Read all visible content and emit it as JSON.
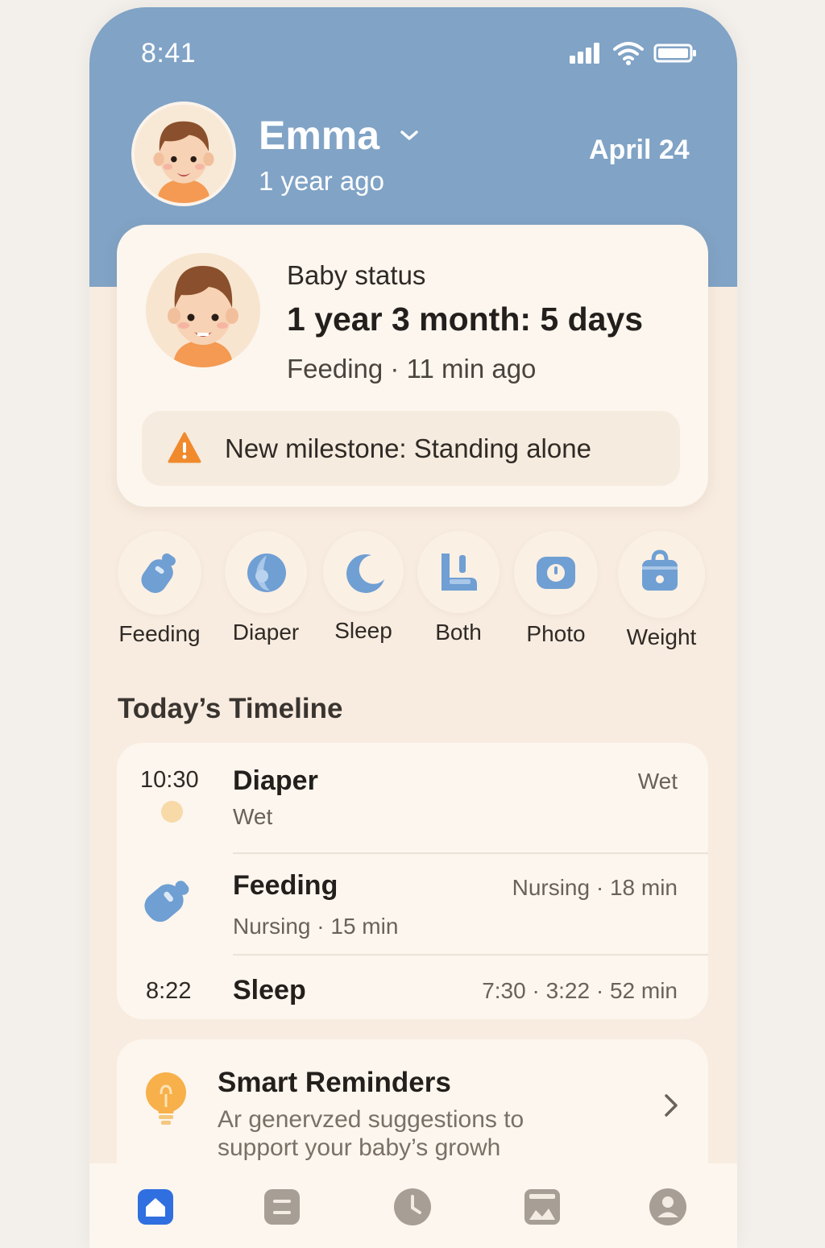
{
  "status_bar": {
    "time": "8:41"
  },
  "profile": {
    "name": "Emma",
    "age_text": "1 year ago",
    "date": "April 24"
  },
  "baby_status": {
    "label": "Baby status",
    "age": "1 year 3 month: 5 days",
    "last_activity": "Feeding · 11 min ago",
    "milestone": "New milestone: Standing alone"
  },
  "quick_actions": [
    {
      "label": "Feeding",
      "icon": "bottle-icon"
    },
    {
      "label": "Diaper",
      "icon": "diaper-icon"
    },
    {
      "label": "Sleep",
      "icon": "moon-icon"
    },
    {
      "label": "Both",
      "icon": "both-icon"
    },
    {
      "label": "Photo",
      "icon": "camera-icon"
    },
    {
      "label": "Weight",
      "icon": "scale-icon"
    }
  ],
  "timeline": {
    "title": "Today’s Timeline",
    "entries": [
      {
        "time": "10:30",
        "title": "Diaper",
        "subtitle": "Wet",
        "right": "Wet"
      },
      {
        "time": "",
        "title": "Feeding",
        "subtitle": "Nursing · 15 min",
        "right": "Nursing · 18 min"
      },
      {
        "time": "8:22",
        "title": "Sleep",
        "subtitle": "",
        "right": "7:30 · 3:22 · 52 min"
      }
    ]
  },
  "reminders": {
    "title": "Smart Reminders",
    "description": "Ar genervzed suggestions to support your baby’s growh"
  },
  "tabs": [
    {
      "name": "home-icon",
      "active": true
    },
    {
      "name": "list-icon",
      "active": false
    },
    {
      "name": "clock-icon",
      "active": false
    },
    {
      "name": "gallery-icon",
      "active": false
    },
    {
      "name": "profile-icon",
      "active": false
    }
  ],
  "colors": {
    "header": "#80a3c6",
    "accent": "#2f6fe0",
    "icon_blue": "#6f9fd3",
    "warning": "#f08a2c",
    "background": "#f8ece0"
  }
}
